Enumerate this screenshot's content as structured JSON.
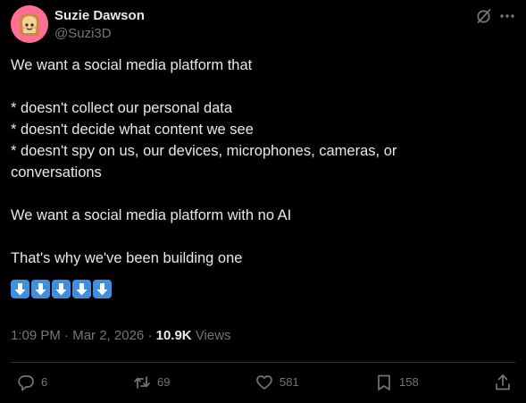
{
  "author": {
    "name": "Suzie Dawson",
    "handle": "@Suzi3D",
    "avatar_icon": "toast-avatar-icon"
  },
  "header_icons": [
    "grok-icon",
    "more-options-icon"
  ],
  "tweet": {
    "lines": [
      "We want a social media platform that",
      "",
      "* doesn't collect our personal data",
      "* doesn't decide what content we see",
      "* doesn't spy on us, our devices, microphones, cameras, or",
      "conversations",
      "",
      "We want a social media platform with no AI",
      "",
      "That's why we've been building one"
    ],
    "emojis": [
      "⬇️",
      "⬇️",
      "⬇️",
      "⬇️",
      "⬇️"
    ]
  },
  "meta": {
    "time": "1:09 PM",
    "separator": "·",
    "date": "Mar 2, 2026",
    "views_count": "10.9K",
    "views_label": "Views"
  },
  "actions": {
    "reply_count": "6",
    "repost_count": "69",
    "like_count": "581",
    "bookmark_count": "158"
  },
  "colors": {
    "background": "#000000",
    "text": "#e7e9ea",
    "secondary": "#71767b",
    "divider": "#2f3336",
    "emoji_blue": "#3d8fe0"
  }
}
